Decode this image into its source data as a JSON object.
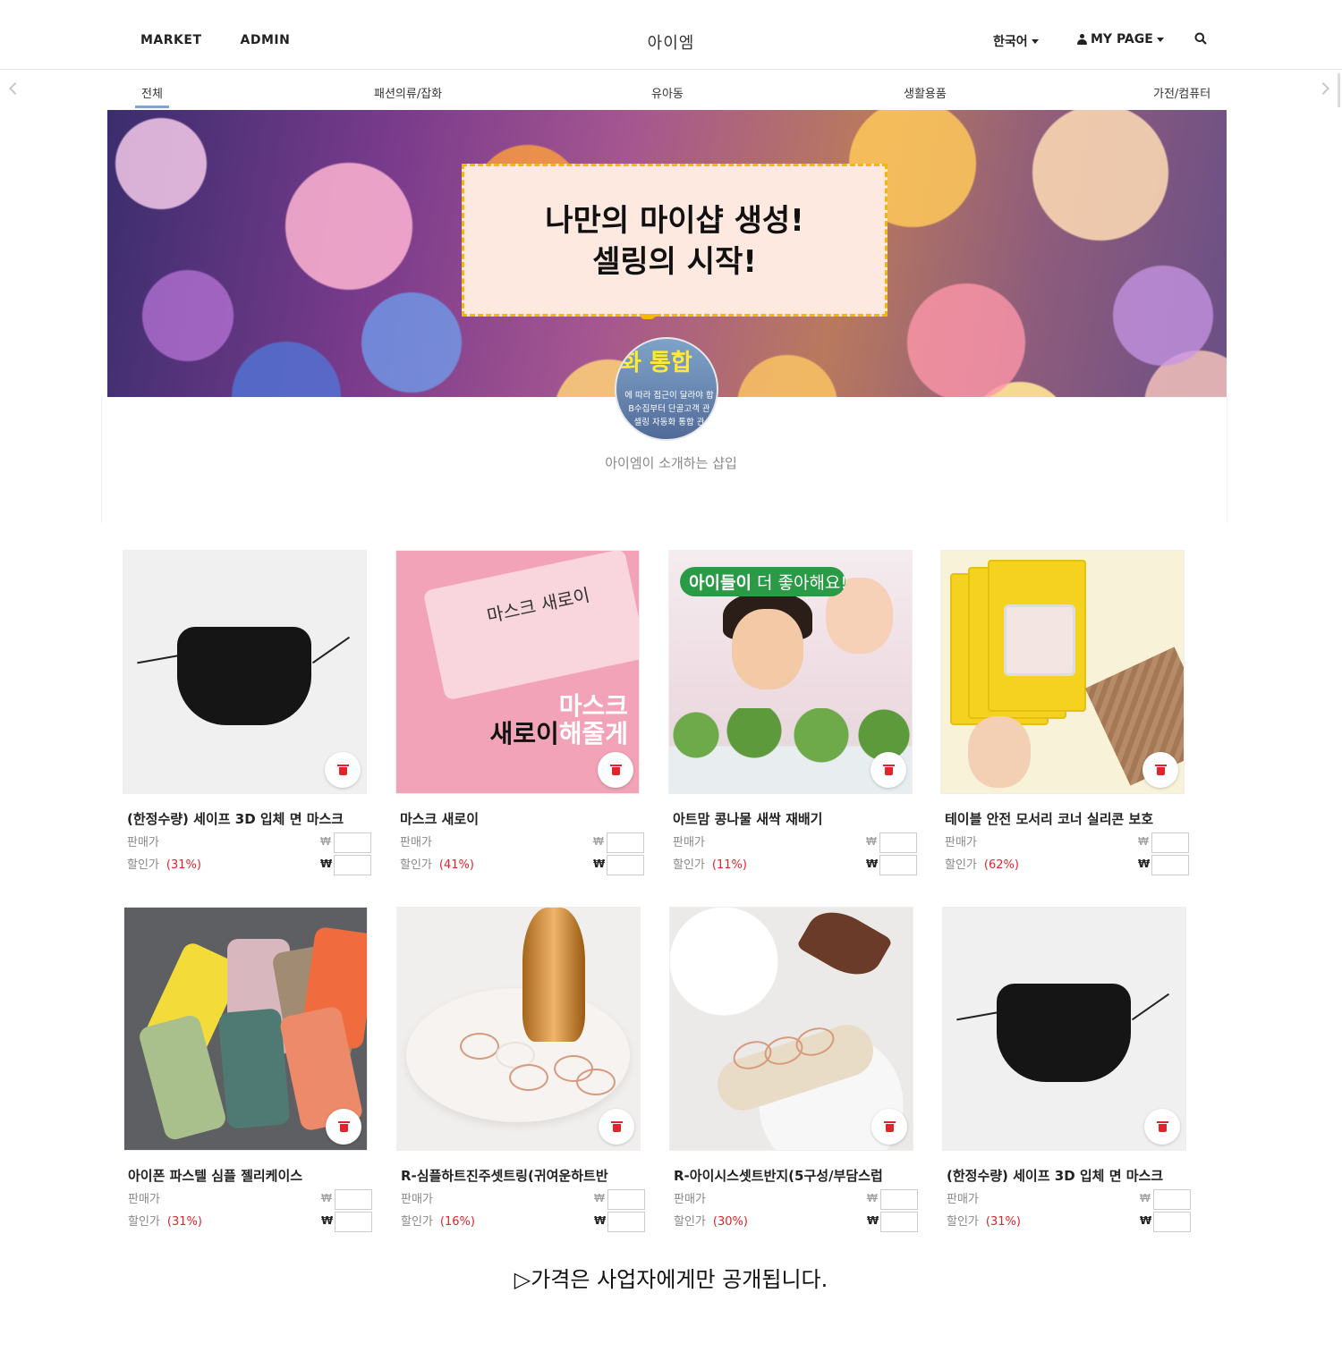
{
  "header": {
    "nav_left": [
      "MARKET",
      "ADMIN"
    ],
    "brand": "아이엠",
    "language": "한국어",
    "mypage": "MY PAGE"
  },
  "categories": [
    "전체",
    "패션의류/잡화",
    "유아동",
    "생활용품",
    "가전/컴퓨터"
  ],
  "banner": {
    "line1": "나만의 마이샵 생성!",
    "line2": "셀링의 시작!"
  },
  "avatar": {
    "headline": "화 통합",
    "line1": "에 따라 접근이 달라야 합",
    "line2": "B수집부터 단골고객 관",
    "line3": "셀링 자동화 통합 관"
  },
  "shop_intro": "아이엠이 소개하는 샵입",
  "labels": {
    "sale_price": "판매가",
    "discount_price": "할인가",
    "won": "₩"
  },
  "products": [
    {
      "title": "(한정수량) 세이프 3D 입체 면 마스크",
      "discount": "(31%)"
    },
    {
      "title": "마스크 새로이",
      "discount": "(41%)"
    },
    {
      "title": "아트맘 콩나물 새싹 재배기",
      "discount": "(11%)"
    },
    {
      "title": "테이블 안전 모서리 코너 실리콘 보호",
      "discount": "(62%)"
    },
    {
      "title": "아이폰 파스텔 심플 젤리케이스",
      "discount": "(31%)"
    },
    {
      "title": "R-심플하트진주셋트링(귀여운하트반",
      "discount": "(16%)"
    },
    {
      "title": "R-아이시스셋트반지(5구성/부담스럽",
      "discount": "(30%)"
    },
    {
      "title": "(한정수량) 세이프 3D 입체 면 마스크",
      "discount": "(31%)"
    }
  ],
  "image_text": {
    "pouch": "마스크 새로이",
    "pink_line1": "마스크",
    "pink_line2_dark": "새로이",
    "pink_line2_light": "해줄게",
    "kids_badge_bold": "아이들이",
    "kids_badge_rest": " 더 좋아해요!"
  },
  "notice": "▷가격은 사업자에게만 공개됩니다.",
  "colors": {
    "accent_underline": "#7aa6d6",
    "discount_red": "#e0242a",
    "banner_box_bg": "#fde9df",
    "banner_box_border": "#f5b800"
  }
}
